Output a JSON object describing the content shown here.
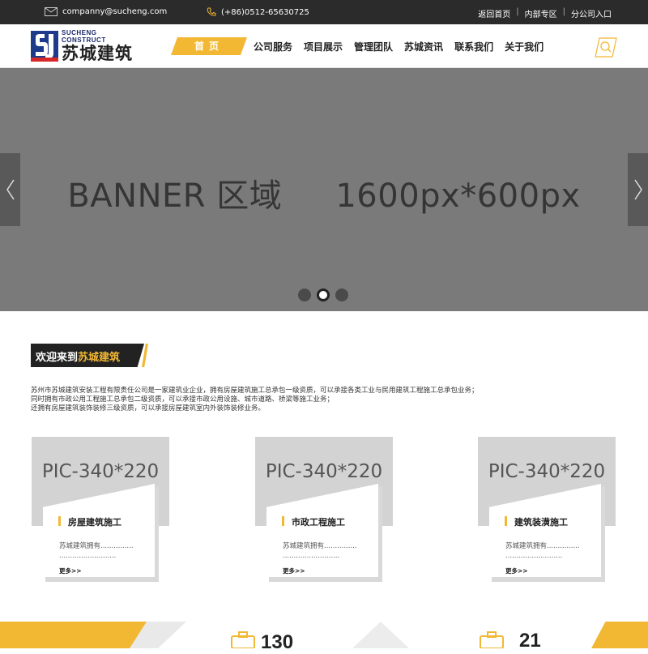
{
  "topbar": {
    "email": "companny@sucheng.com",
    "phone": "(+86)0512-65630725",
    "links": [
      "返回首页",
      "内部专区",
      "分公司入口"
    ],
    "separator": "|"
  },
  "logo": {
    "english": "SUCHENG CONSTRUCT",
    "chinese": "苏城建筑"
  },
  "nav": {
    "active": "首页",
    "items": [
      "公司服务",
      "项目展示",
      "管理团队",
      "苏城资讯",
      "联系我们",
      "关于我们"
    ]
  },
  "banner": {
    "text": "BANNER 区域     1600px*600px",
    "slides": 3,
    "active_slide": 2
  },
  "welcome": {
    "prefix": "欢迎来到",
    "highlight": "苏城建筑"
  },
  "intro": [
    "苏州市苏城建筑安装工程有限责任公司是一家建筑业企业，拥有房屋建筑施工总承包一级资质，可以承接各类工业与民用建筑工程施工总承包业务；",
    "同时拥有市政公用工程施工总承包二级资质，可以承接市政公用设施、城市道路、桥梁等施工业务；",
    "还拥有房屋建筑装饰装修三级资质，可以承接房屋建筑室内外装饰装修业务。"
  ],
  "cards": [
    {
      "pic": "PIC-340*220",
      "title": "房屋建筑施工",
      "desc1": "苏城建筑拥有...............",
      "desc2": "..........................",
      "more": "更多>>"
    },
    {
      "pic": "PIC-340*220",
      "title": "市政工程施工",
      "desc1": "苏城建筑拥有...............",
      "desc2": "..........................",
      "more": "更多>>"
    },
    {
      "pic": "PIC-340*220",
      "title": "建筑装潢施工",
      "desc1": "苏城建筑拥有...............",
      "desc2": "..........................",
      "more": "更多>>"
    }
  ],
  "stats": {
    "numbers": [
      "130",
      "21"
    ]
  },
  "colors": {
    "accent": "#f2b833",
    "topbar": "#2b2b2b",
    "banner": "#7a7a7a"
  }
}
